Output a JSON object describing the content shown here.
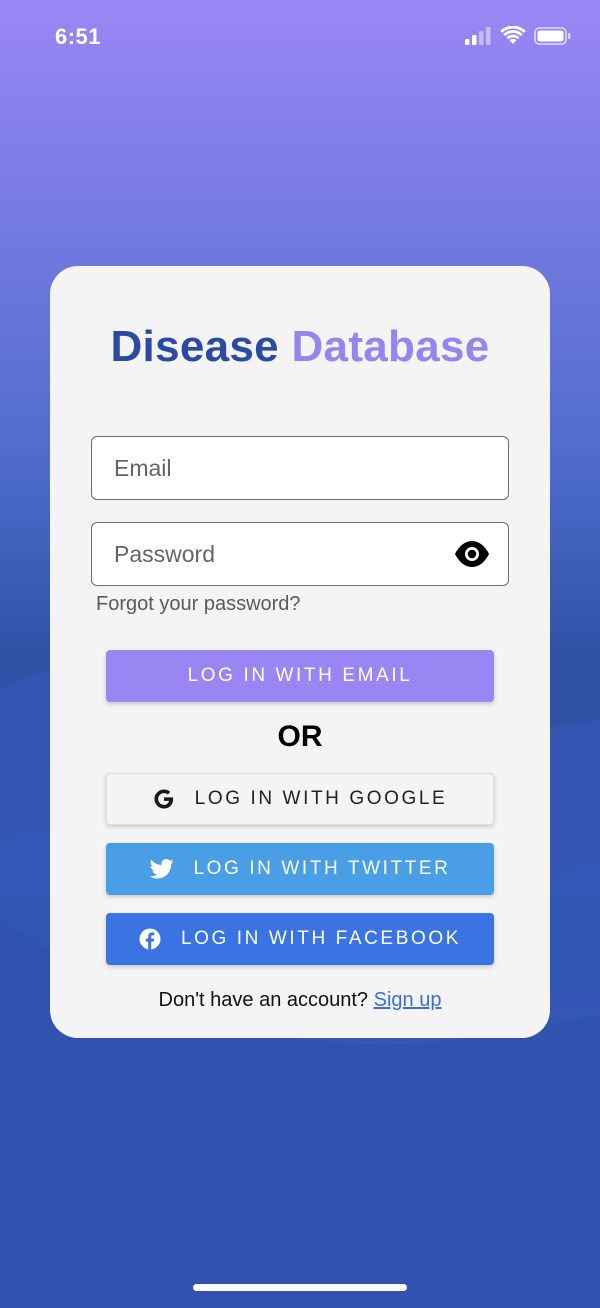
{
  "status_bar": {
    "time": "6:51",
    "icons": [
      "cellular-signal-icon",
      "wifi-icon",
      "battery-icon"
    ]
  },
  "app": {
    "title_part1": "Disease",
    "title_part2": "Database",
    "colors": {
      "title_part1": "#2c4aa3",
      "title_part2": "#9585ee",
      "email_button": "#9a86f2",
      "twitter_button": "#4a9ee6",
      "facebook_button": "#3a74e3",
      "card_background": "#f4f4f4"
    }
  },
  "form": {
    "email": {
      "placeholder": "Email",
      "value": ""
    },
    "password": {
      "placeholder": "Password",
      "value": "",
      "toggle_icon": "eye-icon"
    },
    "forgot_label": "Forgot your password?"
  },
  "buttons": {
    "email": "LOG IN WITH EMAIL",
    "or_label": "OR",
    "google": {
      "label": "LOG IN WITH GOOGLE",
      "icon": "google-icon"
    },
    "twitter": {
      "label": "LOG IN WITH TWITTER",
      "icon": "twitter-icon"
    },
    "facebook": {
      "label": "LOG IN WITH FACEBOOK",
      "icon": "facebook-icon"
    }
  },
  "signup": {
    "prompt": "Don't have an account?",
    "link": "Sign up"
  }
}
